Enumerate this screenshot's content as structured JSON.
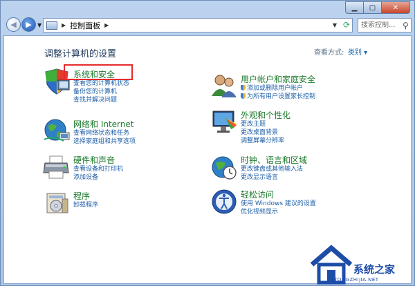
{
  "navbar": {
    "breadcrumb": "控制面板",
    "search_placeholder": "搜索控制..."
  },
  "header": {
    "title": "调整计算机的设置",
    "view_by_label": "查看方式:",
    "view_by_value": "类别"
  },
  "categories_left": [
    {
      "title": "系统和安全",
      "links": [
        "查看您的计算机状态",
        "备份您的计算机",
        "查找并解决问题"
      ]
    },
    {
      "title": "网络和 Internet",
      "links": [
        "查看网络状态和任务",
        "选择家庭组和共享选项"
      ]
    },
    {
      "title": "硬件和声音",
      "links": [
        "查看设备和打印机",
        "添加设备"
      ]
    },
    {
      "title": "程序",
      "links": [
        "卸载程序"
      ]
    }
  ],
  "categories_right": [
    {
      "title": "用户帐户和家庭安全",
      "links": [
        "添加或删除用户帐户",
        "为所有用户设置家长控制"
      ]
    },
    {
      "title": "外观和个性化",
      "links": [
        "更改主题",
        "更改桌面背景",
        "调整屏幕分辨率"
      ]
    },
    {
      "title": "时钟、语言和区域",
      "links": [
        "更改键盘或其他输入法",
        "更改显示语言"
      ]
    },
    {
      "title": "轻松访问",
      "links": [
        "使用 Windows 建议的设置",
        "优化视频显示"
      ]
    }
  ],
  "watermark": {
    "text": "系统之家",
    "sub": "TONGZHIJIA.NET"
  }
}
